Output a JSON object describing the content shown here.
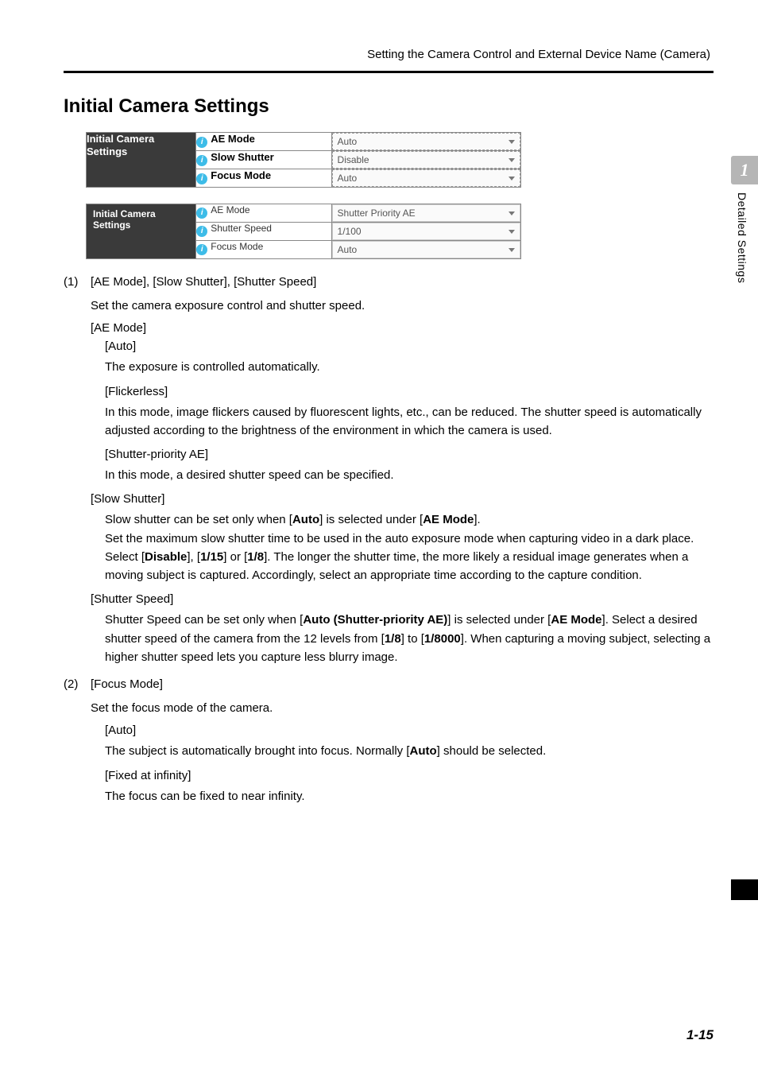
{
  "running_head": "Setting the Camera Control and External Device Name (Camera)",
  "h1": "Initial Camera Settings",
  "table1": {
    "side_label_l1": "Initial Camera",
    "side_label_l2": "Settings",
    "rows": [
      {
        "name": "AE Mode",
        "value": "Auto"
      },
      {
        "name": "Slow Shutter",
        "value": "Disable"
      },
      {
        "name": "Focus Mode",
        "value": "Auto"
      }
    ]
  },
  "table2": {
    "side_label": "Initial Camera Settings",
    "rows": [
      {
        "name": "AE Mode",
        "value": "Shutter Priority AE"
      },
      {
        "name": "Shutter Speed",
        "value": "1/100"
      },
      {
        "name": "Focus Mode",
        "value": "Auto"
      }
    ]
  },
  "item1": {
    "num": "(1)",
    "title": "[AE Mode], [Slow Shutter], [Shutter Speed]",
    "intro": "Set the camera exposure control and shutter speed.",
    "ae_mode_label": "[AE Mode]",
    "auto_label": "[Auto]",
    "auto_text": "The exposure is controlled automatically.",
    "flickerless_label": "[Flickerless]",
    "flickerless_text": "In this mode, image flickers caused by fluorescent lights, etc., can be reduced. The shutter speed is automatically adjusted according to the brightness of the environment in which the camera is used.",
    "spae_label": "[Shutter-priority AE]",
    "spae_text": "In this mode, a desired shutter speed can be specified.",
    "slow_label": "[Slow Shutter]",
    "slow_text_a": "Slow shutter can be set only when [",
    "slow_text_b": "Auto",
    "slow_text_c": "] is selected under [",
    "slow_text_d": "AE Mode",
    "slow_text_e": "].",
    "slow_text2_a": "Set the maximum slow shutter time to be used in the auto exposure mode when capturing video in a dark place. Select [",
    "slow_text2_b": "Disable",
    "slow_text2_c": "], [",
    "slow_text2_d": "1/15",
    "slow_text2_e": "] or [",
    "slow_text2_f": "1/8",
    "slow_text2_g": "]. The longer the shutter time, the more likely a residual image generates when a moving subject is captured. Accordingly, select an appropriate time according to the capture condition.",
    "ss_label": "[Shutter Speed]",
    "ss_text_a": "Shutter Speed can be set only when [",
    "ss_text_b": "Auto (Shutter-priority AE)",
    "ss_text_c": "] is selected under [",
    "ss_text_d": "AE Mode",
    "ss_text_e": "]. Select a desired shutter speed of the camera from the 12 levels from [",
    "ss_text_f": "1/8",
    "ss_text_g": "] to [",
    "ss_text_h": "1/8000",
    "ss_text_i": "]. When capturing a moving subject, selecting a higher shutter speed lets you capture less blurry image."
  },
  "item2": {
    "num": "(2)",
    "title": "[Focus Mode]",
    "intro": "Set the focus mode of the camera.",
    "auto_label": "[Auto]",
    "auto_text_a": "The subject is automatically brought into focus. Normally [",
    "auto_text_b": "Auto",
    "auto_text_c": "] should be selected.",
    "inf_label": "[Fixed at infinity]",
    "inf_text": "The focus can be fixed to near infinity."
  },
  "side_tab": {
    "num": "1",
    "label": "Detailed Settings"
  },
  "footer": "1-15",
  "info_glyph": "i"
}
